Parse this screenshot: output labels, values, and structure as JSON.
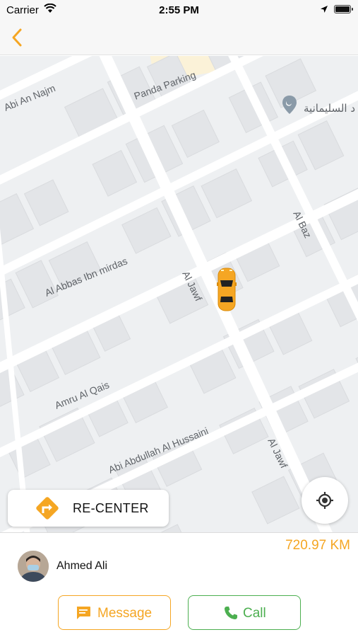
{
  "status_bar": {
    "carrier": "Carrier",
    "time": "2:55 PM"
  },
  "nav": {
    "back_icon": "chevron-left-icon",
    "accent_color": "#f5a623"
  },
  "map": {
    "streets": [
      "Abi An Najm",
      "Panda Parking",
      "Al Abbas Ibn mirdas",
      "Al Jawf",
      "Al Baz",
      "Amru Al Qais",
      "Abi Abdullah Al Hussaini",
      "Al Jawf"
    ],
    "poi_label": "د السليمانية",
    "vehicle_icon": "taxi-car-icon",
    "recenter_label": "RE-CENTER"
  },
  "trip": {
    "distance": "720.97 KM"
  },
  "driver": {
    "name": "Ahmed Ali"
  },
  "actions": {
    "message_label": "Message",
    "call_label": "Call",
    "message_color": "#f5a623",
    "call_color": "#4caf50"
  }
}
